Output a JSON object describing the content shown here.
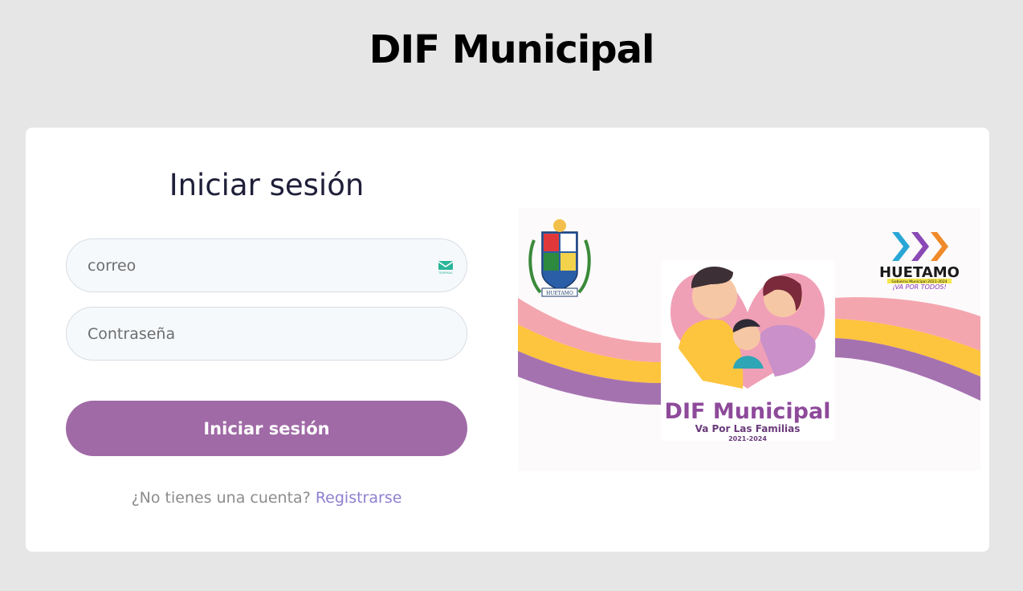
{
  "header": {
    "title": "DIF Municipal"
  },
  "login": {
    "heading": "Iniciar sesión",
    "email_placeholder": "correo",
    "password_placeholder": "Contraseña",
    "submit_label": "Iniciar sesión",
    "no_account_text": "¿No tienes una cuenta?",
    "register_link": "Registrarse"
  },
  "banner": {
    "brand_title": "DIF Municipal",
    "slogan": "Va Por Las Familias",
    "years": "2021-2024",
    "city_name": "HUETAMO",
    "city_tagline": "Gobierno Municipal 2021-2024",
    "city_slogan": "¡VA POR TODOS!",
    "seal_label": "HUETAMO",
    "email_icon_label": "TEMPMAIL"
  },
  "colors": {
    "page_bg": "#e6e6e6",
    "card_bg": "#ffffff",
    "accent": "#a06aa6",
    "link": "#8f7fd0",
    "stripe_pink": "#f4a6ae",
    "stripe_yellow": "#fdc43e",
    "stripe_purple": "#a572b0"
  },
  "icons": {
    "email": "envelope-icon",
    "seal": "municipal-seal-icon",
    "city_logo": "chevron-arrows-icon"
  }
}
